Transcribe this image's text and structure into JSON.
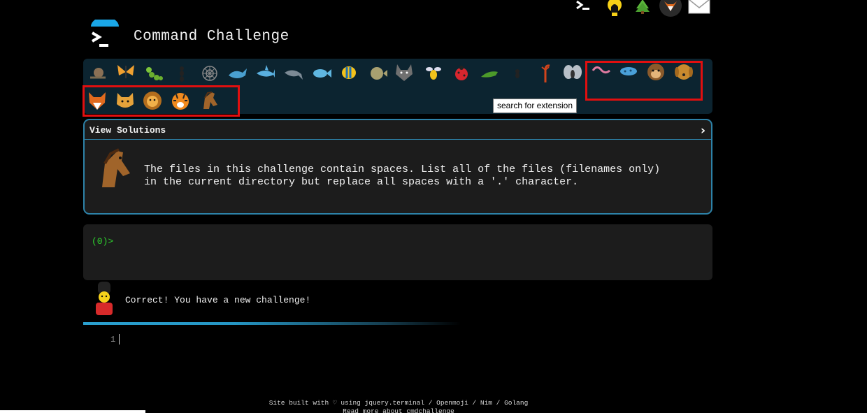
{
  "header": {
    "title": "Command Challenge",
    "top_icons": [
      "terminal-icon",
      "idea-hand-icon",
      "tree-icon",
      "fox-avatar-icon",
      "mail-icon"
    ]
  },
  "challenge_bar": {
    "row1": [
      "snail-icon",
      "butterfly-icon",
      "caterpillar-icon",
      "ant-icon",
      "spider-web-icon",
      "whale-icon",
      "shark-icon",
      "dolphin-icon",
      "fish-icon",
      "tropical-fish-icon",
      "blowfish-icon",
      "wolf-icon",
      "bee-icon",
      "ladybug-icon",
      "cricket-icon",
      "spider-icon",
      "scorpion-icon",
      "fly-icon",
      "worm-icon",
      "microbe-icon",
      "monkey-icon",
      "dog-icon"
    ],
    "row2": [
      "fox-icon",
      "cat-icon",
      "lion-icon",
      "tiger-icon",
      "horse-icon"
    ],
    "tooltip": "search for extension"
  },
  "solutions": {
    "label": "View Solutions",
    "expand_glyph": "›",
    "challenge": "The files in this challenge contain spaces. List all of the files (filenames only)\nin the current directory but replace all spaces with a '.' character."
  },
  "terminal": {
    "prompt": "(0)>"
  },
  "feedback": {
    "message": "Correct! You have a new challenge!"
  },
  "editor": {
    "line_number": "1"
  },
  "footer": {
    "line1_a": "Site built with",
    "line1_heart": "♡",
    "line1_b": "using jquery.terminal / Openmoji / Nim / Golang",
    "line2": "Read more about cmdchallenge"
  },
  "colors": {
    "accent": "#2d82a8",
    "bar_bg": "#0c2430",
    "prompt": "#2fd22f",
    "highlight": "#e10f0f"
  }
}
